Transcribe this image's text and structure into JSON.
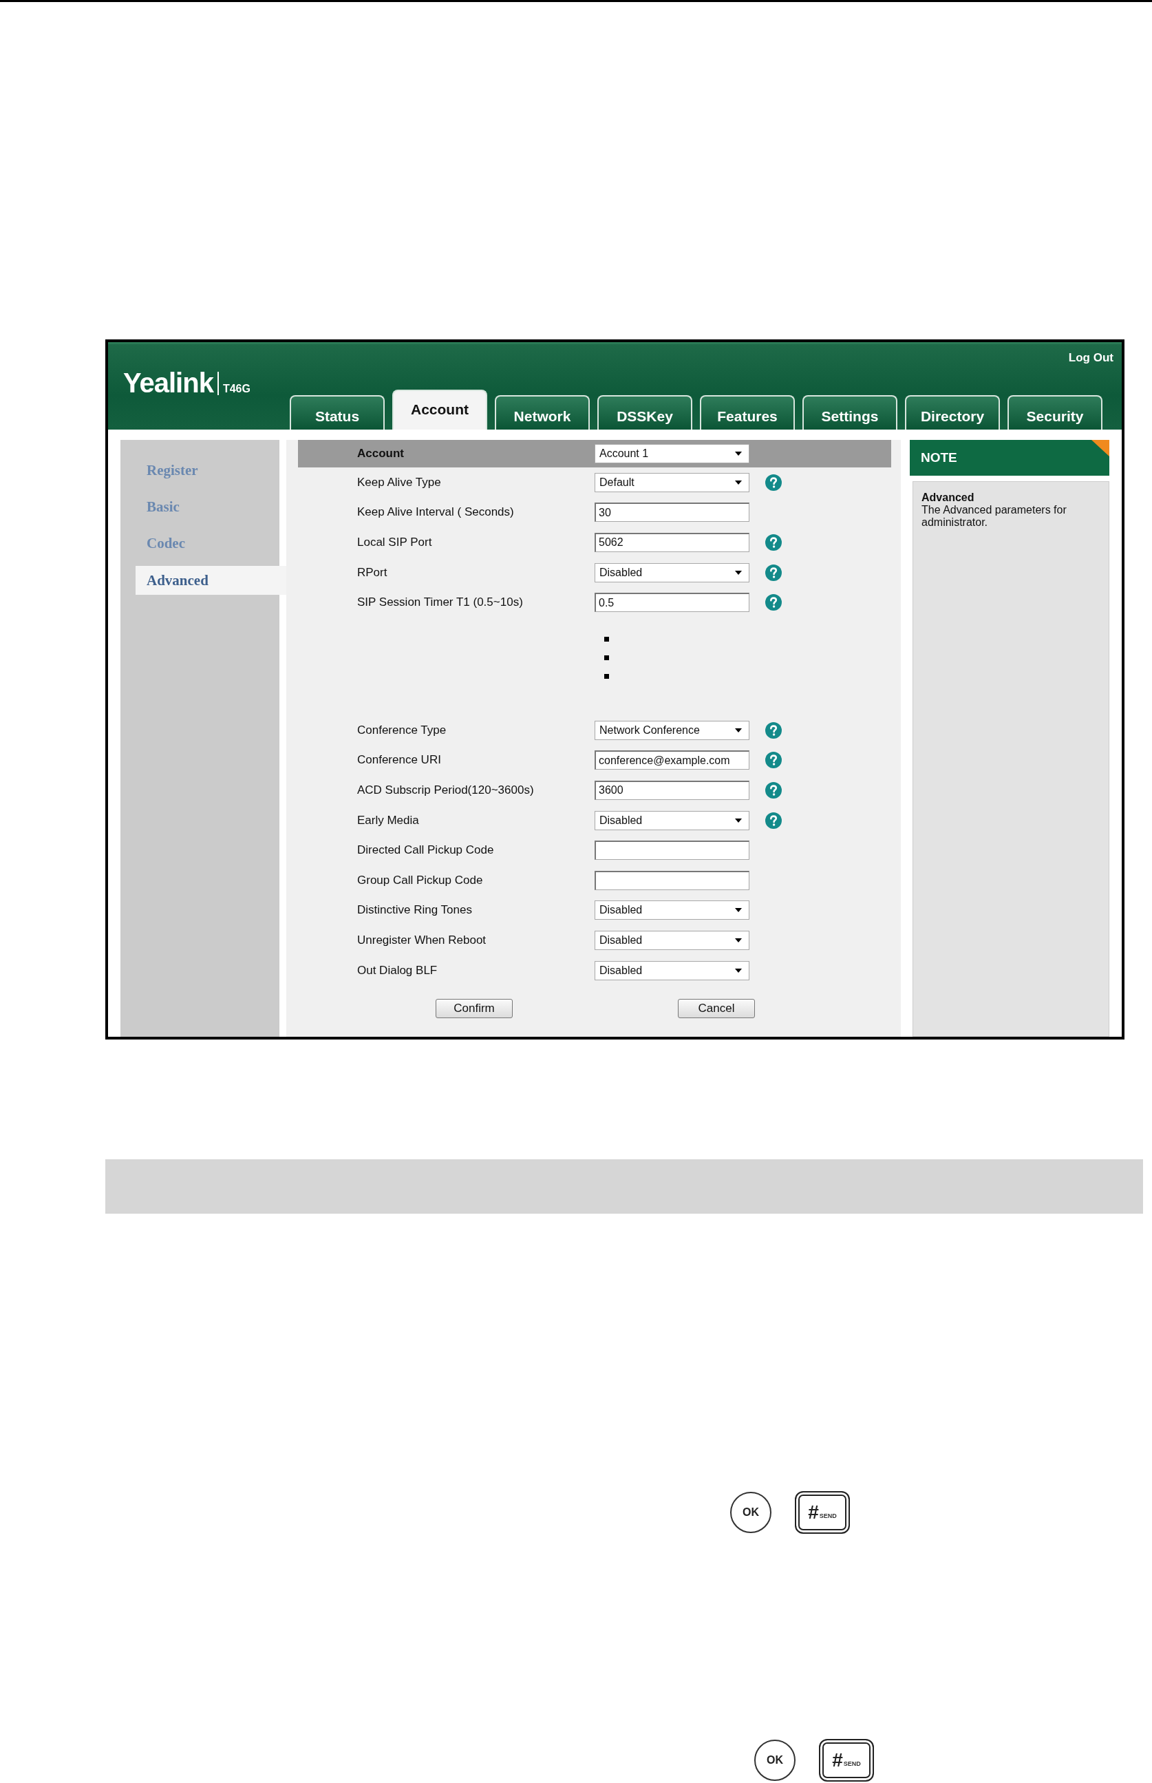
{
  "window": {
    "logo": "Yealink",
    "model": "T46G",
    "logout": "Log Out"
  },
  "tabs": [
    {
      "label": "Status",
      "selected": false
    },
    {
      "label": "Account",
      "selected": true
    },
    {
      "label": "Network",
      "selected": false
    },
    {
      "label": "DSSKey",
      "selected": false
    },
    {
      "label": "Features",
      "selected": false
    },
    {
      "label": "Settings",
      "selected": false
    },
    {
      "label": "Directory",
      "selected": false
    },
    {
      "label": "Security",
      "selected": false
    }
  ],
  "sidebar": {
    "items": [
      {
        "label": "Register",
        "selected": false
      },
      {
        "label": "Basic",
        "selected": false
      },
      {
        "label": "Codec",
        "selected": false
      },
      {
        "label": "Advanced",
        "selected": true
      }
    ]
  },
  "form": {
    "header": {
      "label": "Account",
      "value": "Account 1"
    },
    "rows": [
      {
        "kind": "select",
        "label": "Keep Alive Type",
        "value": "Default",
        "help": true
      },
      {
        "kind": "input",
        "label": "Keep Alive Interval ( Seconds)",
        "value": "30",
        "help": false
      },
      {
        "kind": "input",
        "label": "Local SIP Port",
        "value": "5062",
        "help": true
      },
      {
        "kind": "select",
        "label": "RPort",
        "value": "Disabled",
        "help": true
      },
      {
        "kind": "input",
        "label": "SIP Session Timer T1 (0.5~10s)",
        "value": "0.5",
        "help": true
      },
      {
        "kind": "ellipsis"
      },
      {
        "kind": "select",
        "label": "Conference Type",
        "value": "Network Conference",
        "help": true
      },
      {
        "kind": "input",
        "label": "Conference URI",
        "value": "conference@example.com",
        "help": true
      },
      {
        "kind": "input",
        "label": "ACD Subscrip Period(120~3600s)",
        "value": "3600",
        "help": true
      },
      {
        "kind": "select",
        "label": "Early Media",
        "value": "Disabled",
        "help": true
      },
      {
        "kind": "input",
        "label": "Directed Call Pickup Code",
        "help": false
      },
      {
        "kind": "input",
        "label": "Group Call Pickup Code",
        "help": false
      },
      {
        "kind": "select",
        "label": "Distinctive Ring Tones",
        "value": "Disabled",
        "help": false
      },
      {
        "kind": "select",
        "label": "Unregister When Reboot",
        "value": "Disabled",
        "help": false
      },
      {
        "kind": "select",
        "label": "Out Dialog BLF",
        "value": "Disabled",
        "help": false
      }
    ],
    "buttons": [
      "Confirm",
      "Cancel"
    ]
  },
  "note": {
    "title": "NOTE",
    "heading": "Advanced",
    "text": "The Advanced parameters for administrator."
  },
  "keys": [
    {
      "ok": "OK",
      "hash": "#",
      "send": "SEND"
    },
    {
      "ok": "OK",
      "hash": "#",
      "send": "SEND"
    }
  ]
}
